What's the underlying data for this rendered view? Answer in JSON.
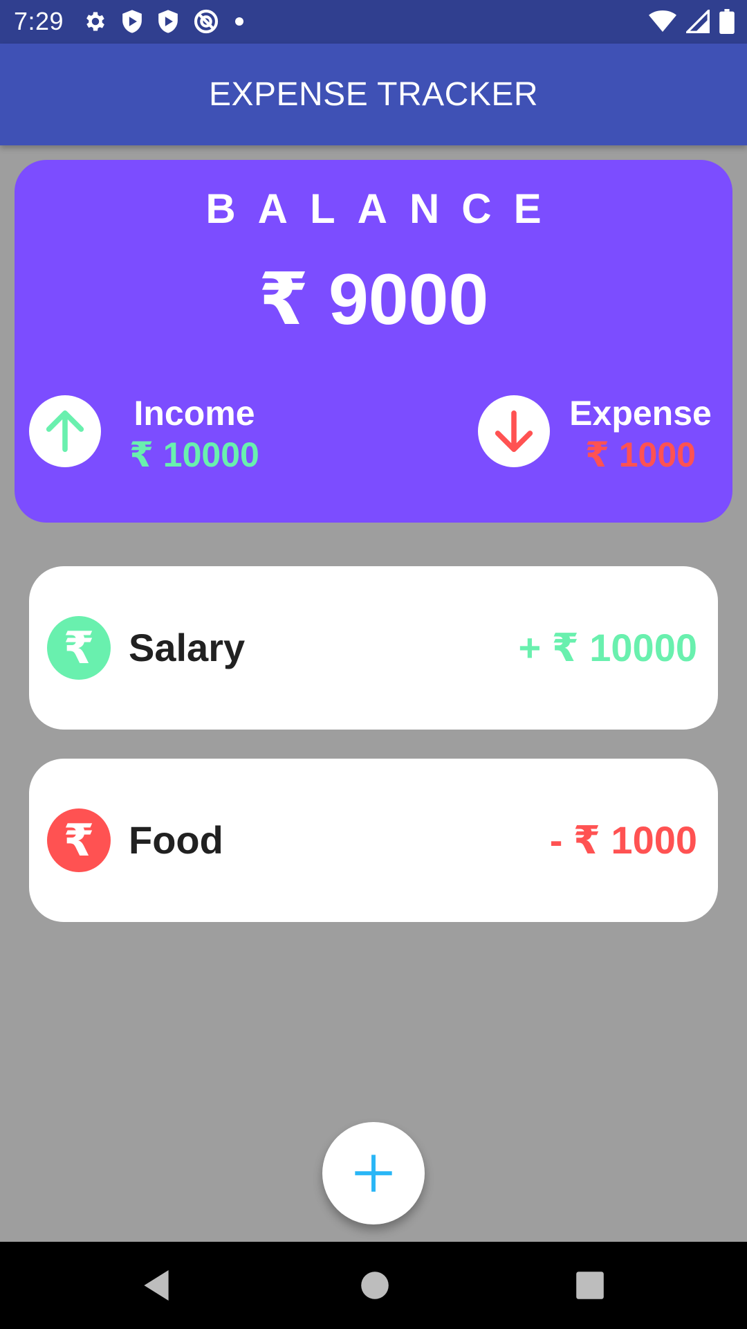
{
  "status_bar": {
    "time": "7:29",
    "left_icons": [
      "settings-icon",
      "shield-play-icon",
      "shield-play-icon",
      "no-sim-icon",
      "dot-icon"
    ],
    "right_icons": [
      "wifi-icon",
      "signal-icon",
      "battery-icon"
    ]
  },
  "app_bar": {
    "title": "EXPENSE TRACKER"
  },
  "balance": {
    "label": "BALANCE",
    "amount": "₹ 9000",
    "income": {
      "label": "Income",
      "amount": "₹ 10000"
    },
    "expense": {
      "label": "Expense",
      "amount": "₹ 1000"
    }
  },
  "transactions": [
    {
      "name": "Salary",
      "amount": "+ ₹ 10000",
      "type": "income",
      "icon": "rupee-icon"
    },
    {
      "name": "Food",
      "amount": "- ₹ 1000",
      "type": "expense",
      "icon": "rupee-icon"
    }
  ],
  "fab": {
    "icon": "plus-icon"
  },
  "colors": {
    "status_bar": "#303f8f",
    "app_bar": "#3f51b5",
    "card": "#7c4dff",
    "income": "#69f0ae",
    "expense": "#ff5252",
    "fab_icon": "#29b6f6",
    "background": "#9e9e9e"
  },
  "nav_bar": {
    "buttons": [
      "back-icon",
      "home-icon",
      "recents-icon"
    ]
  }
}
